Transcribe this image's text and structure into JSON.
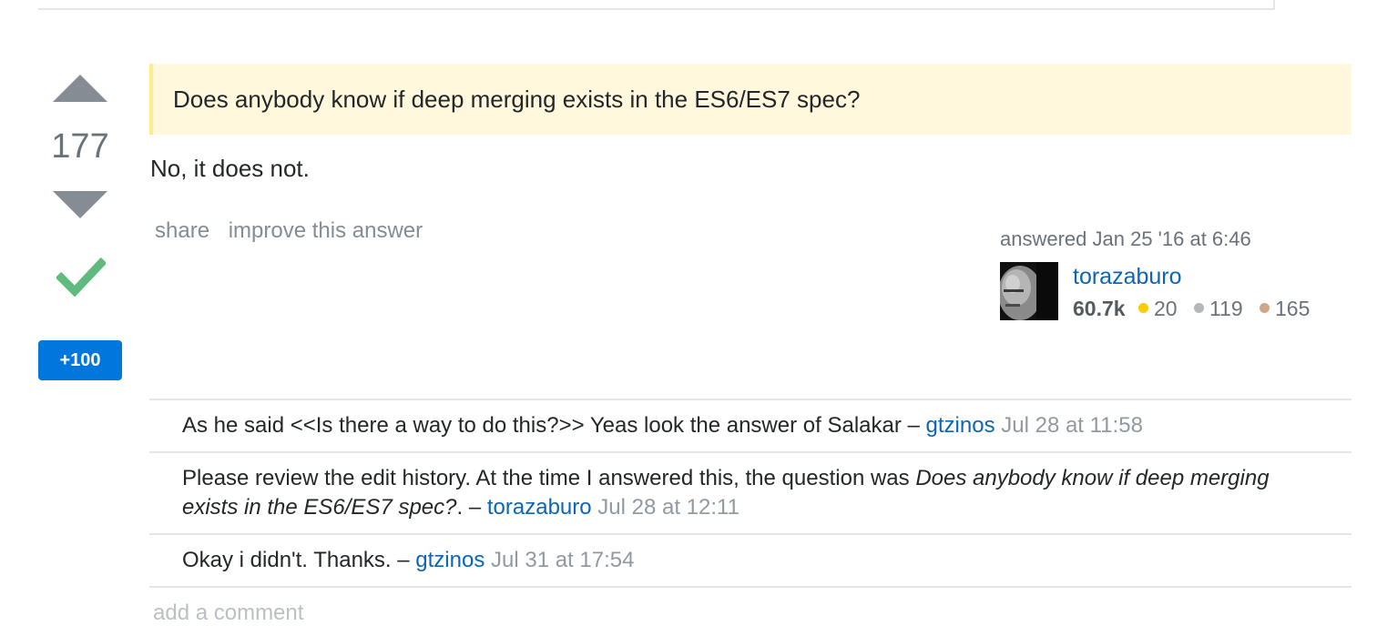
{
  "answer": {
    "vote_count": "177",
    "bounty_label": "+100",
    "quote_text": "Does anybody know if deep merging exists in the ES6/ES7 spec?",
    "body_text": "No, it does not.",
    "menu": {
      "share_label": "share",
      "improve_label": "improve this answer"
    },
    "author": {
      "answered_label": "answered Jan 25 '16 at 6:46",
      "name": "torazaburo",
      "reputation": "60.7k",
      "gold_count": "20",
      "silver_count": "119",
      "bronze_count": "165"
    }
  },
  "comments": [
    {
      "text": "As he said <<Is there a way to do this?>> Yeas look the answer of Salakar",
      "sep": " – ",
      "user": "gtzinos",
      "date": "Jul 28 at 11:58"
    },
    {
      "text_before": "Please review the edit history. At the time I answered this, the question was ",
      "text_em": "Does anybody know if deep merging exists in the ES6/ES7 spec?",
      "text_after": ".",
      "sep": " – ",
      "user": "torazaburo",
      "date": "Jul 28 at 12:11"
    },
    {
      "text": "Okay i didn't. Thanks.",
      "sep": " – ",
      "user": "gtzinos",
      "date": "Jul 31 at 17:54"
    }
  ],
  "add_comment_label": "add a comment",
  "colors": {
    "link": "#0c65b8",
    "accent_bounty": "#0077dd",
    "accepted_check": "#5fba7d",
    "quote_bg": "#fff8dc",
    "badge_gold": "#ffcc01",
    "badge_silver": "#b4b8bc",
    "badge_bronze": "#d1a684"
  },
  "icons": {
    "upvote": "arrow-up-icon",
    "downvote": "arrow-down-icon",
    "accepted": "checkmark-icon"
  }
}
